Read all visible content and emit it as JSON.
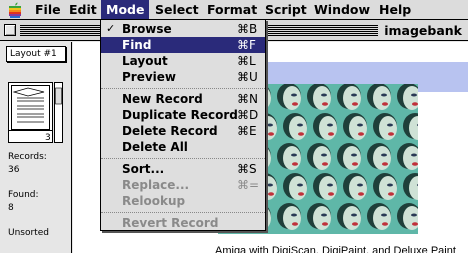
{
  "menubar": {
    "items": [
      "File",
      "Edit",
      "Mode",
      "Select",
      "Format",
      "Script",
      "Window",
      "Help"
    ],
    "active": "Mode"
  },
  "window": {
    "title": "imagebank"
  },
  "status_panel": {
    "layout_popup": "Layout #1",
    "page_number": "3",
    "records_label": "Records:",
    "records_value": "36",
    "found_label": "Found:",
    "found_value": "8",
    "sort_status": "Unsorted"
  },
  "record": {
    "caption": "Amiga with DigiScan, DigiPaint, and Deluxe Paint"
  },
  "mode_menu": {
    "items": [
      {
        "label": "Browse",
        "shortcut": "⌘B",
        "checked": true,
        "highlighted": false,
        "disabled": false
      },
      {
        "label": "Find",
        "shortcut": "⌘F",
        "checked": false,
        "highlighted": true,
        "disabled": false
      },
      {
        "label": "Layout",
        "shortcut": "⌘L",
        "checked": false,
        "highlighted": false,
        "disabled": false
      },
      {
        "label": "Preview",
        "shortcut": "⌘U",
        "checked": false,
        "highlighted": false,
        "disabled": false
      },
      {
        "label": "New Record",
        "shortcut": "⌘N",
        "checked": false,
        "highlighted": false,
        "disabled": false
      },
      {
        "label": "Duplicate Record",
        "shortcut": "⌘D",
        "checked": false,
        "highlighted": false,
        "disabled": false
      },
      {
        "label": "Delete Record",
        "shortcut": "⌘E",
        "checked": false,
        "highlighted": false,
        "disabled": false
      },
      {
        "label": "Delete All",
        "shortcut": "",
        "checked": false,
        "highlighted": false,
        "disabled": false
      },
      {
        "label": "Sort...",
        "shortcut": "⌘S",
        "checked": false,
        "highlighted": false,
        "disabled": false
      },
      {
        "label": "Replace...",
        "shortcut": "⌘=",
        "checked": false,
        "highlighted": false,
        "disabled": true
      },
      {
        "label": "Relookup",
        "shortcut": "",
        "checked": false,
        "highlighted": false,
        "disabled": true
      },
      {
        "label": "Revert Record",
        "shortcut": "",
        "checked": false,
        "highlighted": false,
        "disabled": true
      }
    ],
    "check_glyph": "✓"
  },
  "colors": {
    "highlight": "#2a2a7a",
    "photo_bg": "#5fb7a8",
    "field_bg": "#b8c3f0"
  }
}
